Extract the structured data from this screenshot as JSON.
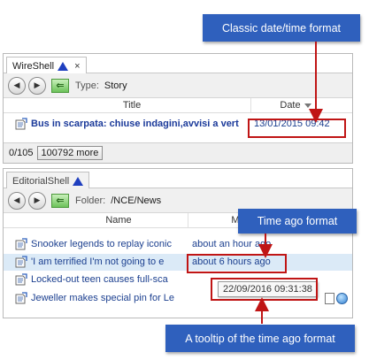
{
  "callouts": {
    "classic": "Classic date/time format",
    "time_ago": "Time ago format",
    "tooltip": "A tooltip of the time ago format"
  },
  "wireshell": {
    "tab_label": "WireShell",
    "tab_close": "×",
    "toolbar_label": "Type:",
    "toolbar_value": "Story",
    "columns": {
      "title": "Title",
      "date": "Date"
    },
    "row": {
      "title": "Bus in scarpata: chiuse indagini,avvisi a vert",
      "date": "13/01/2015 09:42"
    },
    "status": {
      "count": "0/105",
      "more_button": "100792 more"
    }
  },
  "editorial": {
    "tab_label": "EditorialShell",
    "toolbar_label": "Folder:",
    "toolbar_value": "/NCE/News",
    "columns": {
      "name": "Name",
      "modified": "Mo"
    },
    "rows": [
      {
        "name": "Snooker legends to replay iconic",
        "modified": "about an hour ago"
      },
      {
        "name": "'I am terrified I'm not going to e",
        "modified": "about 6 hours ago"
      },
      {
        "name": "Locked-out teen causes full-sca",
        "modified": ""
      },
      {
        "name": "Jeweller makes special pin for Le",
        "modified": ""
      }
    ],
    "tooltip": "22/09/2016 09:31:38"
  },
  "icons": {
    "back": "arrow-left-icon",
    "forward": "arrow-right-icon",
    "green": "green-arrow-icon",
    "story": "story-icon",
    "sort": "sort-desc-icon",
    "doc": "document-icon",
    "globe": "globe-icon"
  },
  "colors": {
    "callout_bg": "#2f60bd",
    "highlight_red": "#c01515",
    "link_blue": "#1b3f8f",
    "selection": "#dbeaf7"
  }
}
